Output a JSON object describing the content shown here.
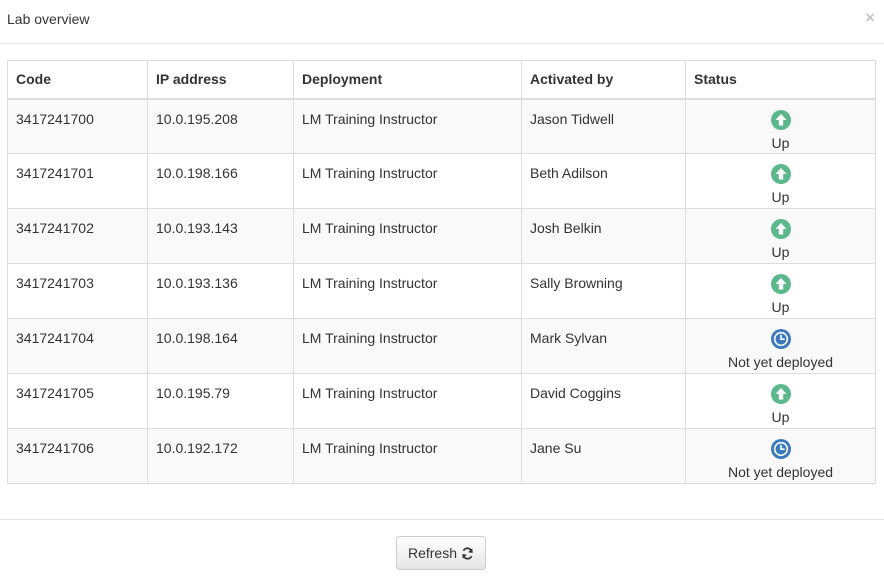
{
  "modal": {
    "title": "Lab overview",
    "close_glyph": "×"
  },
  "table": {
    "headers": [
      "Code",
      "IP address",
      "Deployment",
      "Activated by",
      "Status"
    ],
    "rows": [
      {
        "code": "3417241700",
        "ip": "10.0.195.208",
        "deployment": "LM Training Instructor",
        "activated_by": "Jason Tidwell",
        "status": "Up",
        "status_icon": "arrow-up-circle-icon"
      },
      {
        "code": "3417241701",
        "ip": "10.0.198.166",
        "deployment": "LM Training Instructor",
        "activated_by": "Beth Adilson",
        "status": "Up",
        "status_icon": "arrow-up-circle-icon"
      },
      {
        "code": "3417241702",
        "ip": "10.0.193.143",
        "deployment": "LM Training Instructor",
        "activated_by": "Josh Belkin",
        "status": "Up",
        "status_icon": "arrow-up-circle-icon"
      },
      {
        "code": "3417241703",
        "ip": "10.0.193.136",
        "deployment": "LM Training Instructor",
        "activated_by": "Sally Browning",
        "status": "Up",
        "status_icon": "arrow-up-circle-icon"
      },
      {
        "code": "3417241704",
        "ip": "10.0.198.164",
        "deployment": "LM Training Instructor",
        "activated_by": "Mark Sylvan",
        "status": "Not yet deployed",
        "status_icon": "clock-icon"
      },
      {
        "code": "3417241705",
        "ip": "10.0.195.79",
        "deployment": "LM Training Instructor",
        "activated_by": "David Coggins",
        "status": "Up",
        "status_icon": "arrow-up-circle-icon"
      },
      {
        "code": "3417241706",
        "ip": "10.0.192.172",
        "deployment": "LM Training Instructor",
        "activated_by": "Jane Su",
        "status": "Not yet deployed",
        "status_icon": "clock-icon"
      }
    ]
  },
  "footer": {
    "refresh_label": "Refresh",
    "refresh_icon": "refresh-icon"
  },
  "colors": {
    "status_up": "#5cb88c",
    "status_pending": "#3a7bbf",
    "row_stripe": "#f9f9f9",
    "border": "#dddddd"
  }
}
